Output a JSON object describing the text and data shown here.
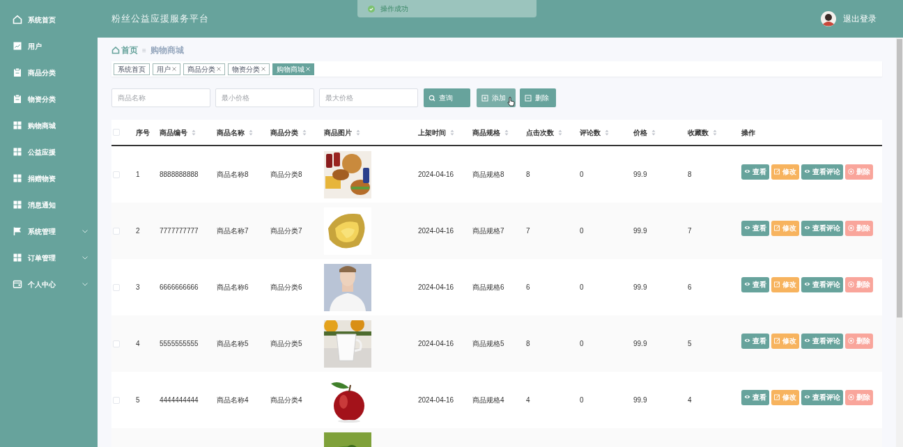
{
  "toast": {
    "text": "操作成功"
  },
  "header": {
    "title": "粉丝公益应援服务平台",
    "logout": "退出登录"
  },
  "sidebar": {
    "items": [
      {
        "label": "系统首页",
        "kind": "home",
        "expandable": false
      },
      {
        "label": "用户",
        "kind": "chart",
        "expandable": false
      },
      {
        "label": "商品分类",
        "kind": "clipboard",
        "expandable": false
      },
      {
        "label": "物资分类",
        "kind": "clipboard",
        "expandable": false
      },
      {
        "label": "购物商城",
        "kind": "grid",
        "expandable": false
      },
      {
        "label": "公益应援",
        "kind": "grid",
        "expandable": false
      },
      {
        "label": "捐赠物资",
        "kind": "grid",
        "expandable": false
      },
      {
        "label": "消息通知",
        "kind": "grid",
        "expandable": false
      },
      {
        "label": "系统管理",
        "kind": "flag",
        "expandable": true
      },
      {
        "label": "订单管理",
        "kind": "grid",
        "expandable": true
      },
      {
        "label": "个人中心",
        "kind": "wallet",
        "expandable": true
      }
    ]
  },
  "breadcrumb": {
    "home": "首页",
    "separator": "≡",
    "current": "购物商城"
  },
  "tags": [
    {
      "label": "系统首页",
      "closable": false,
      "selected": false
    },
    {
      "label": "用户",
      "closable": true,
      "selected": false
    },
    {
      "label": "商品分类",
      "closable": true,
      "selected": false
    },
    {
      "label": "物资分类",
      "closable": true,
      "selected": false
    },
    {
      "label": "购物商城",
      "closable": true,
      "selected": true
    }
  ],
  "search": {
    "fields": [
      {
        "placeholder": "商品名称"
      },
      {
        "placeholder": "最小价格"
      },
      {
        "placeholder": "最大价格"
      }
    ],
    "buttons": [
      {
        "label": "查询",
        "kind": "search",
        "hovered": false
      },
      {
        "label": "添加",
        "kind": "add",
        "hovered": true
      },
      {
        "label": "删除",
        "kind": "remove",
        "hovered": false
      }
    ]
  },
  "table": {
    "header_checked": false,
    "columns": [
      {
        "label": "序号",
        "sortable": false
      },
      {
        "label": "商品编号",
        "sortable": true
      },
      {
        "label": "商品名称",
        "sortable": true
      },
      {
        "label": "商品分类",
        "sortable": true
      },
      {
        "label": "商品图片",
        "sortable": true
      },
      {
        "label": "上架时间",
        "sortable": true
      },
      {
        "label": "商品规格",
        "sortable": true
      },
      {
        "label": "点击次数",
        "sortable": true
      },
      {
        "label": "评论数",
        "sortable": true
      },
      {
        "label": "价格",
        "sortable": true
      },
      {
        "label": "收藏数",
        "sortable": true
      },
      {
        "label": "操作",
        "sortable": false
      }
    ],
    "rows": [
      {
        "checked": false,
        "cells": [
          "1",
          "8888888888",
          "商品名称8",
          "商品分类8",
          {
            "kind": "picture"
          },
          "2024-04-16",
          "商品规格8",
          "8",
          "0",
          "99.9",
          "8"
        ],
        "actions": [
          {
            "label": "查看",
            "kind": "view"
          },
          {
            "label": "修改",
            "kind": "edit"
          },
          {
            "label": "查看评论",
            "kind": "view"
          },
          {
            "label": "删除",
            "kind": "delete"
          }
        ]
      },
      {
        "checked": false,
        "cells": [
          "2",
          "7777777777",
          "商品名称7",
          "商品分类7",
          {
            "kind": "picture"
          },
          "2024-04-16",
          "商品规格7",
          "7",
          "0",
          "99.9",
          "7"
        ],
        "actions": [
          {
            "label": "查看",
            "kind": "view"
          },
          {
            "label": "修改",
            "kind": "edit"
          },
          {
            "label": "查看评论",
            "kind": "view"
          },
          {
            "label": "删除",
            "kind": "delete"
          }
        ]
      },
      {
        "checked": false,
        "cells": [
          "3",
          "6666666666",
          "商品名称6",
          "商品分类6",
          {
            "kind": "picture"
          },
          "2024-04-16",
          "商品规格6",
          "6",
          "0",
          "99.9",
          "6"
        ],
        "actions": [
          {
            "label": "查看",
            "kind": "view"
          },
          {
            "label": "修改",
            "kind": "edit"
          },
          {
            "label": "查看评论",
            "kind": "view"
          },
          {
            "label": "删除",
            "kind": "delete"
          }
        ]
      },
      {
        "checked": false,
        "cells": [
          "4",
          "5555555555",
          "商品名称5",
          "商品分类5",
          {
            "kind": "picture"
          },
          "2024-04-16",
          "商品规格5",
          "8",
          "0",
          "99.9",
          "5"
        ],
        "actions": [
          {
            "label": "查看",
            "kind": "view"
          },
          {
            "label": "修改",
            "kind": "edit"
          },
          {
            "label": "查看评论",
            "kind": "view"
          },
          {
            "label": "删除",
            "kind": "delete"
          }
        ]
      },
      {
        "checked": false,
        "cells": [
          "5",
          "4444444444",
          "商品名称4",
          "商品分类4",
          {
            "kind": "picture"
          },
          "2024-04-16",
          "商品规格4",
          "4",
          "0",
          "99.9",
          "4"
        ],
        "actions": [
          {
            "label": "查看",
            "kind": "view"
          },
          {
            "label": "修改",
            "kind": "edit"
          },
          {
            "label": "查看评论",
            "kind": "view"
          },
          {
            "label": "删除",
            "kind": "delete"
          }
        ]
      },
      {
        "cut_off": true,
        "cells": [
          {
            "kind": "picture"
          }
        ]
      }
    ]
  }
}
